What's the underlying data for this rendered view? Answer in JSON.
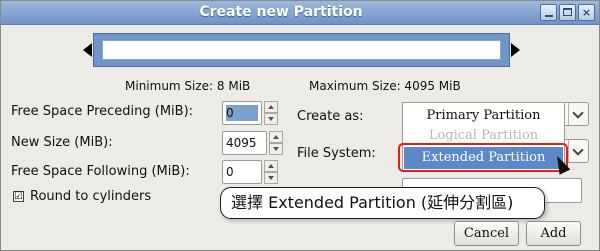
{
  "window": {
    "title": "Create new Partition"
  },
  "sizes": {
    "minimum": "Minimum Size: 8 MiB",
    "maximum": "Maximum Size: 4095 MiB"
  },
  "fields": {
    "free_space_preceding_label": "Free Space Preceding (MiB):",
    "free_space_preceding_value": "0",
    "new_size_label": "New Size (MiB):",
    "new_size_value": "4095",
    "free_space_following_label": "Free Space Following (MiB):",
    "free_space_following_value": "0",
    "round_to_cylinders_label": "Round to cylinders",
    "round_to_cylinders_checked": "☑"
  },
  "options": {
    "create_as_label": "Create as:",
    "create_as_items": [
      "Primary Partition",
      "Logical Partition",
      "Extended Partition"
    ],
    "file_system_label": "File System:"
  },
  "callout": "選擇 Extended Partition (延伸分割區)",
  "buttons": {
    "cancel": "Cancel",
    "add": "Add"
  },
  "colors": {
    "title_bar": "#6f93c6",
    "selection": "#5a88c9",
    "highlight_border": "#e0211b"
  }
}
